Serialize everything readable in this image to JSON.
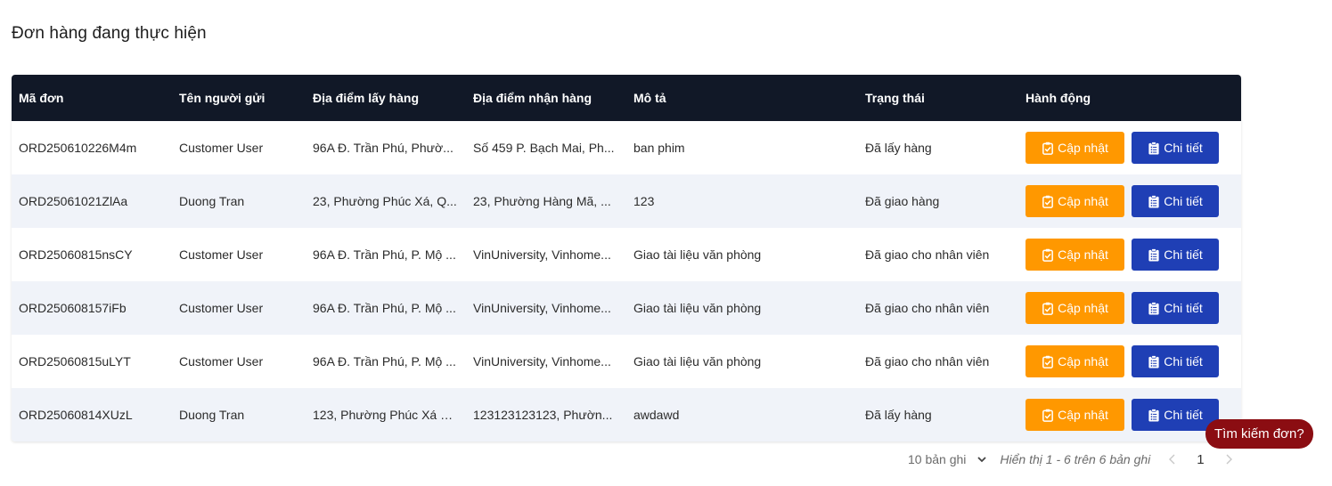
{
  "page": {
    "title": "Đơn hàng đang thực hiện"
  },
  "table": {
    "headers": {
      "code": "Mã đơn",
      "sender": "Tên người gửi",
      "pickup": "Địa điểm lấy hàng",
      "delivery": "Địa điểm nhận hàng",
      "description": "Mô tả",
      "status": "Trạng thái",
      "actions": "Hành động"
    },
    "rows": [
      {
        "code": "ORD250610226M4m",
        "sender": "Customer User",
        "pickup": "96A Đ. Trần Phú, Phườ...",
        "delivery": "Số 459 P. Bạch Mai, Ph...",
        "description": "ban phim",
        "status": "Đã lấy hàng"
      },
      {
        "code": "ORD25061021ZlAa",
        "sender": "Duong Tran",
        "pickup": "23, Phường Phúc Xá, Q...",
        "delivery": "23, Phường Hàng Mã, ...",
        "description": "123",
        "status": "Đã giao hàng"
      },
      {
        "code": "ORD25060815nsCY",
        "sender": "Customer User",
        "pickup": "96A Đ. Trần Phú, P. Mộ ...",
        "delivery": "VinUniversity, Vinhome...",
        "description": "Giao tài liệu văn phòng",
        "status": "Đã giao cho nhân viên"
      },
      {
        "code": "ORD250608157iFb",
        "sender": "Customer User",
        "pickup": "96A Đ. Trần Phú, P. Mộ ...",
        "delivery": "VinUniversity, Vinhome...",
        "description": "Giao tài liệu văn phòng",
        "status": "Đã giao cho nhân viên"
      },
      {
        "code": "ORD25060815uLYT",
        "sender": "Customer User",
        "pickup": "96A Đ. Trần Phú, P. Mộ ...",
        "delivery": "VinUniversity, Vinhome...",
        "description": "Giao tài liệu văn phòng",
        "status": "Đã giao cho nhân viên"
      },
      {
        "code": "ORD25060814XUzL",
        "sender": "Duong Tran",
        "pickup": "123, Phường Phúc Xá Q...",
        "delivery": "123123123123, Phườn...",
        "description": "awdawd",
        "status": "Đã lấy hàng"
      }
    ],
    "update_label": "Cập nhật",
    "detail_label": "Chi tiết"
  },
  "pagination": {
    "page_size": "10 bản ghi",
    "range_text": "Hiển thị 1 - 6 trên 6 bản ghi",
    "current_page": "1"
  },
  "search_pill": {
    "label": "Tìm kiếm đơn?"
  },
  "colors": {
    "header_bg": "#111827",
    "update_btn": "#ff9800",
    "detail_btn": "#1f3fb5",
    "search_pill": "#8b0d12",
    "row_alt": "#f0f3f9"
  },
  "icons": {
    "update": "clipboard-check-icon",
    "detail": "clipboard-list-icon"
  }
}
